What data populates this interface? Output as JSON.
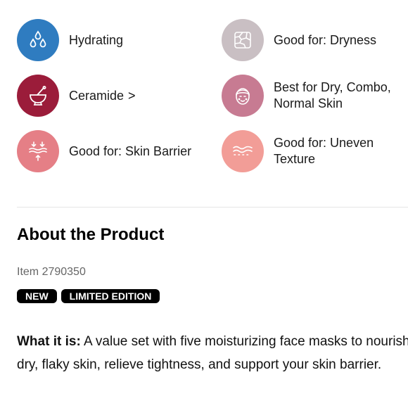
{
  "attributes": [
    {
      "label": "Hydrating",
      "icon": "water-drops-icon",
      "color": "#2f7cc0"
    },
    {
      "label": "Ceramide",
      "chevron": ">",
      "icon": "mortar-bowl-icon",
      "color": "#9b1c3a"
    },
    {
      "label": "Good for: Skin Barrier",
      "icon": "skin-barrier-icon",
      "color": "#e57f86"
    },
    {
      "label": "Good for: Dryness",
      "icon": "dry-texture-icon",
      "color": "#c9bfc3"
    },
    {
      "label_line1": "Best for Dry, Combo,",
      "label_line2": "Normal Skin",
      "icon": "face-icon",
      "color": "#c77b92"
    },
    {
      "label_line1": "Good for: Uneven",
      "label_line2": "Texture",
      "icon": "uneven-texture-icon",
      "color": "#f29d97"
    }
  ],
  "about": {
    "title": "About the Product",
    "item": "Item 2790350",
    "badges": [
      "NEW",
      "LIMITED EDITION"
    ],
    "what_it_is_label": "What it is:",
    "what_it_is_text": " A value set with five moisturizing face masks to nourish dry, flaky skin, relieve tightness, and support your skin barrier."
  }
}
